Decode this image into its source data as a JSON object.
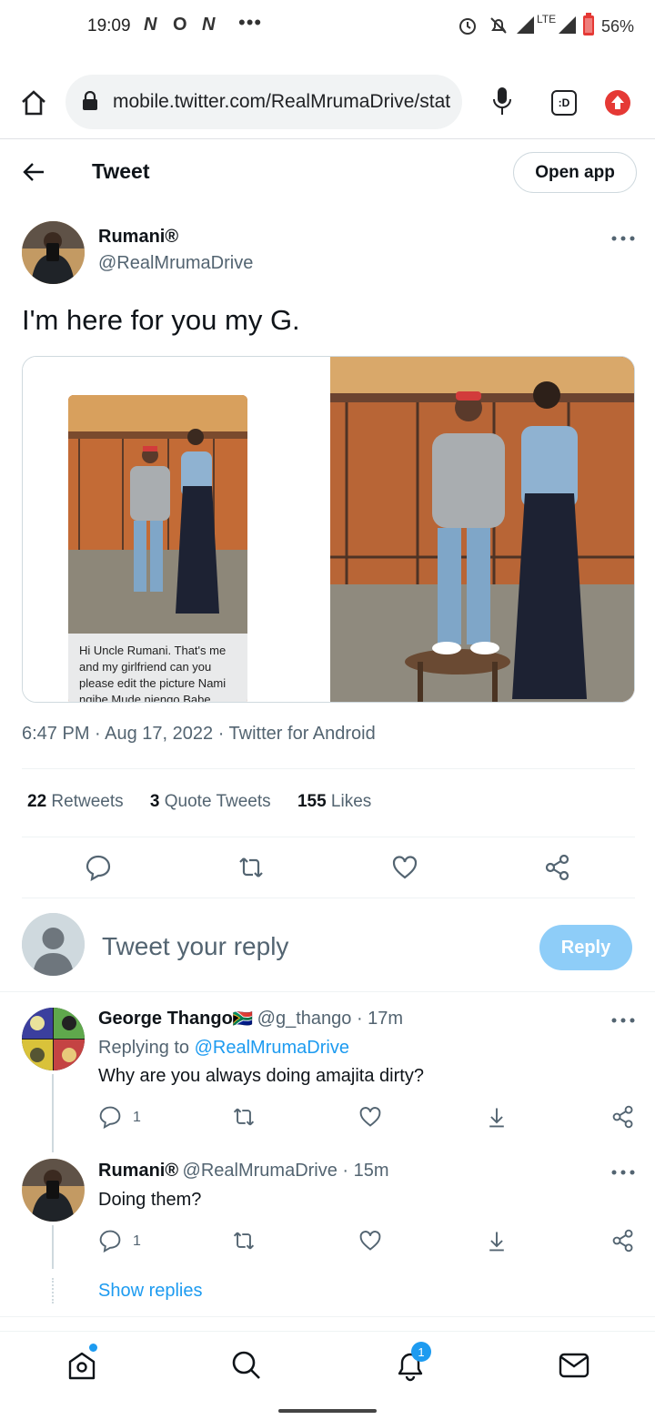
{
  "status_bar": {
    "time": "19:09",
    "notif_icons": [
      "N",
      "O",
      "N"
    ],
    "more": "•••",
    "network": "LTE",
    "battery": "56%"
  },
  "browser": {
    "url": "mobile.twitter.com/RealMrumaDrive/status",
    "tab_count_icon": ":D"
  },
  "header": {
    "title": "Tweet",
    "open_app": "Open app"
  },
  "tweet": {
    "author_name": "Rumani®",
    "author_handle": "@RealMrumaDrive",
    "text": "I'm here for you my G.",
    "media_caption": "Hi Uncle Rumani. That's me and my girlfriend can you please edit the picture Nami ngibe Mude njengo Babe",
    "timestamp": "6:47 PM · Aug 17, 2022 · Twitter for Android",
    "stats": {
      "retweets_count": "22",
      "retweets_label": "Retweets",
      "quotes_count": "3",
      "quotes_label": "Quote Tweets",
      "likes_count": "155",
      "likes_label": "Likes"
    }
  },
  "reply_box": {
    "placeholder": "Tweet your reply",
    "button": "Reply"
  },
  "replies": [
    {
      "name": "George Thango",
      "flag": "🇿🇦",
      "handle_time": "@g_thango · 17m",
      "replying_prefix": "Replying to",
      "replying_to": "@RealMrumaDrive",
      "text": "Why are you always doing amajita dirty?",
      "reply_count": "1"
    },
    {
      "name": "Rumani®",
      "handle_time": "@RealMrumaDrive · 15m",
      "text": "Doing them?",
      "reply_count": "1"
    }
  ],
  "show_replies": "Show replies",
  "nav": {
    "notifications_badge": "1"
  },
  "colors": {
    "accent": "#1d9bf0",
    "reply_button": "#8ecdf8",
    "secondary_text": "#536471"
  }
}
